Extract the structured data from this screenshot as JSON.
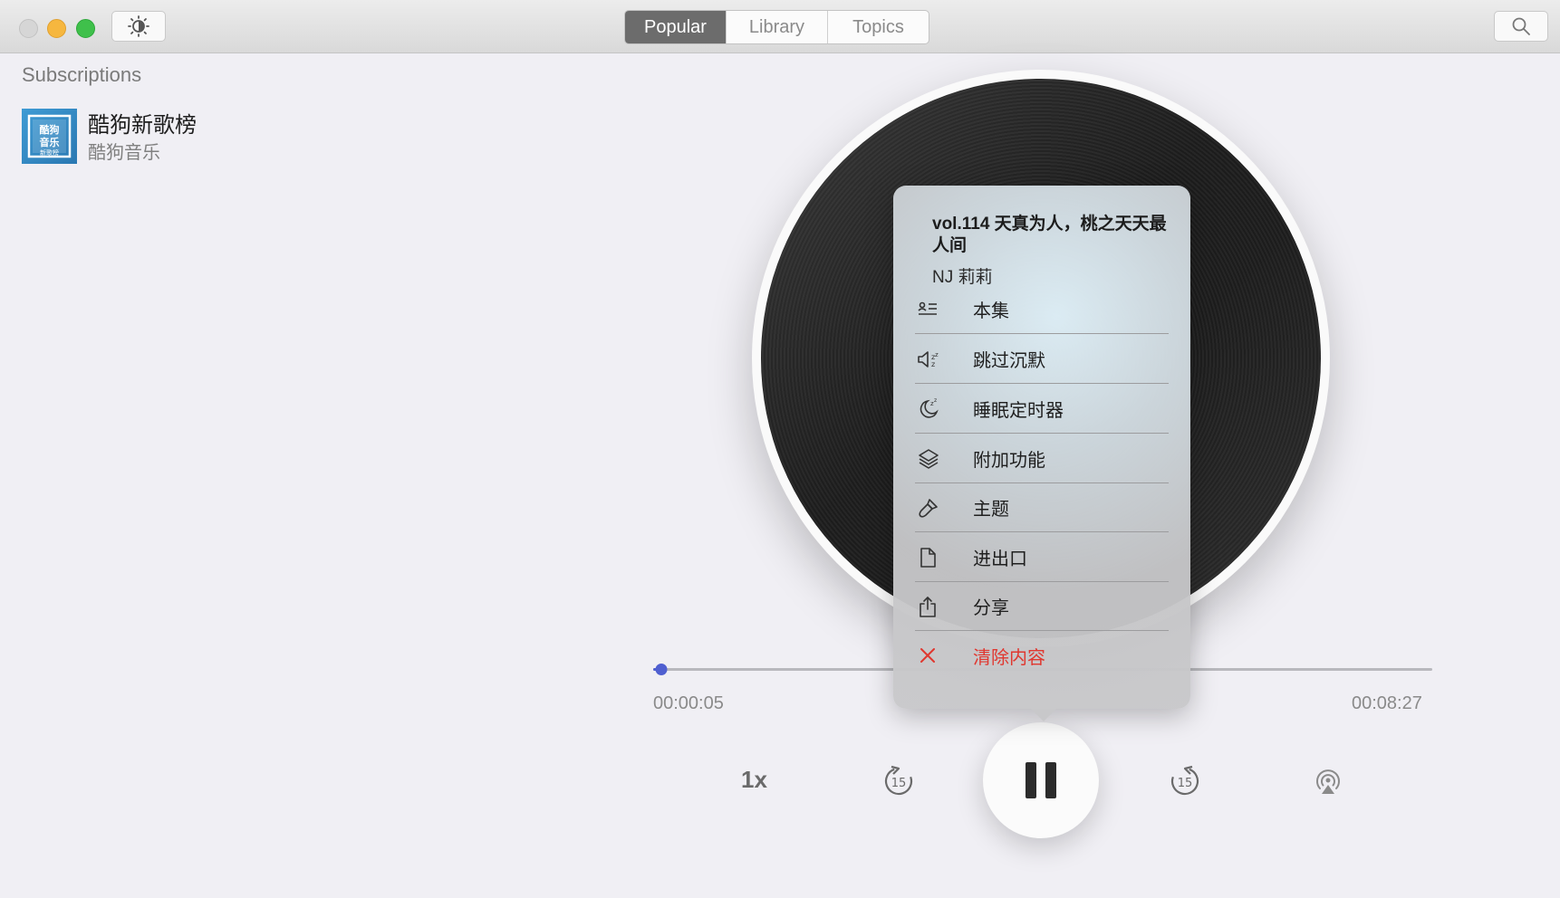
{
  "toolbar": {
    "tabs": [
      {
        "label": "Popular",
        "active": true
      },
      {
        "label": "Library",
        "active": false
      },
      {
        "label": "Topics",
        "active": false
      }
    ],
    "theme_icon": "sun-moon-icon",
    "search_icon": "search-icon"
  },
  "sidebar": {
    "heading": "Subscriptions",
    "podcasts": [
      {
        "title": "酷狗新歌榜",
        "author": "酷狗音乐",
        "artwork_text": "酷狗音乐 新歌榜"
      }
    ]
  },
  "player": {
    "elapsed": "00:00:05",
    "total": "00:08:27",
    "progress_fraction": 0.0099,
    "rate": "1x",
    "skip_back_seconds": "15",
    "skip_forward_seconds": "15",
    "state": "playing"
  },
  "menu": {
    "episode_title": "vol.114 天真为人，桃之天天最人间",
    "episode_author": "NJ 莉莉",
    "items": [
      {
        "label": "本集",
        "icon": "episode-info-icon"
      },
      {
        "label": "跳过沉默",
        "icon": "skip-silence-icon"
      },
      {
        "label": "睡眠定时器",
        "icon": "sleep-timer-icon"
      },
      {
        "label": "附加功能",
        "icon": "layers-icon"
      },
      {
        "label": "主题",
        "icon": "brush-icon"
      },
      {
        "label": "进出口",
        "icon": "document-icon"
      },
      {
        "label": "分享",
        "icon": "share-icon"
      },
      {
        "label": "清除内容",
        "icon": "close-icon",
        "danger": true
      }
    ]
  },
  "colors": {
    "accent": "#4f5fd0",
    "danger": "#e0372f",
    "tab_active": "#6c6c6c"
  }
}
